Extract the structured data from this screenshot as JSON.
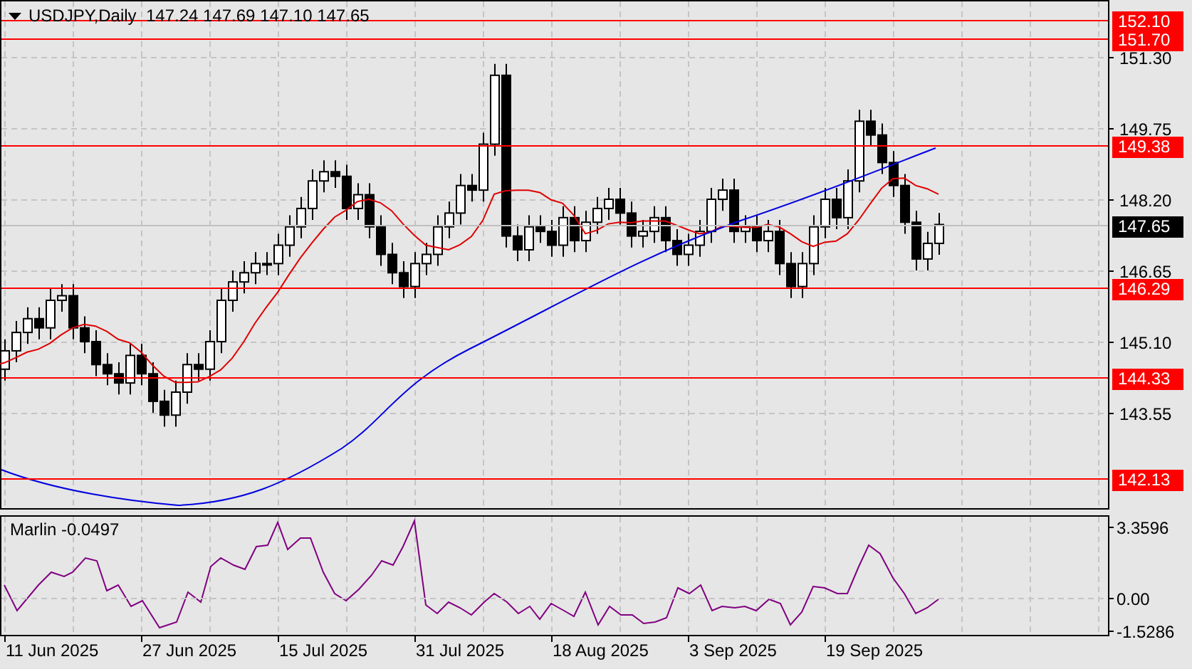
{
  "header": {
    "symbol_line": "USDJPY,Daily  147.24 147.69 147.10 147.65"
  },
  "price_axis": [
    "151.30",
    "149.75",
    "148.20",
    "146.65",
    "145.10",
    "143.55"
  ],
  "levels": [
    "152.10",
    "151.70",
    "149.38",
    "146.29",
    "144.33",
    "142.13"
  ],
  "current_price": "147.65",
  "indicator": {
    "name": "Marlin -0.0497",
    "axis": [
      "3.3596",
      "0.00",
      "-1.5286"
    ]
  },
  "date_axis": [
    "11 Jun 2025",
    "27 Jun 2025",
    "15 Jul 2025",
    "31 Jul 2025",
    "18 Aug 2025",
    "3 Sep 2025",
    "19 Sep 2025"
  ]
}
